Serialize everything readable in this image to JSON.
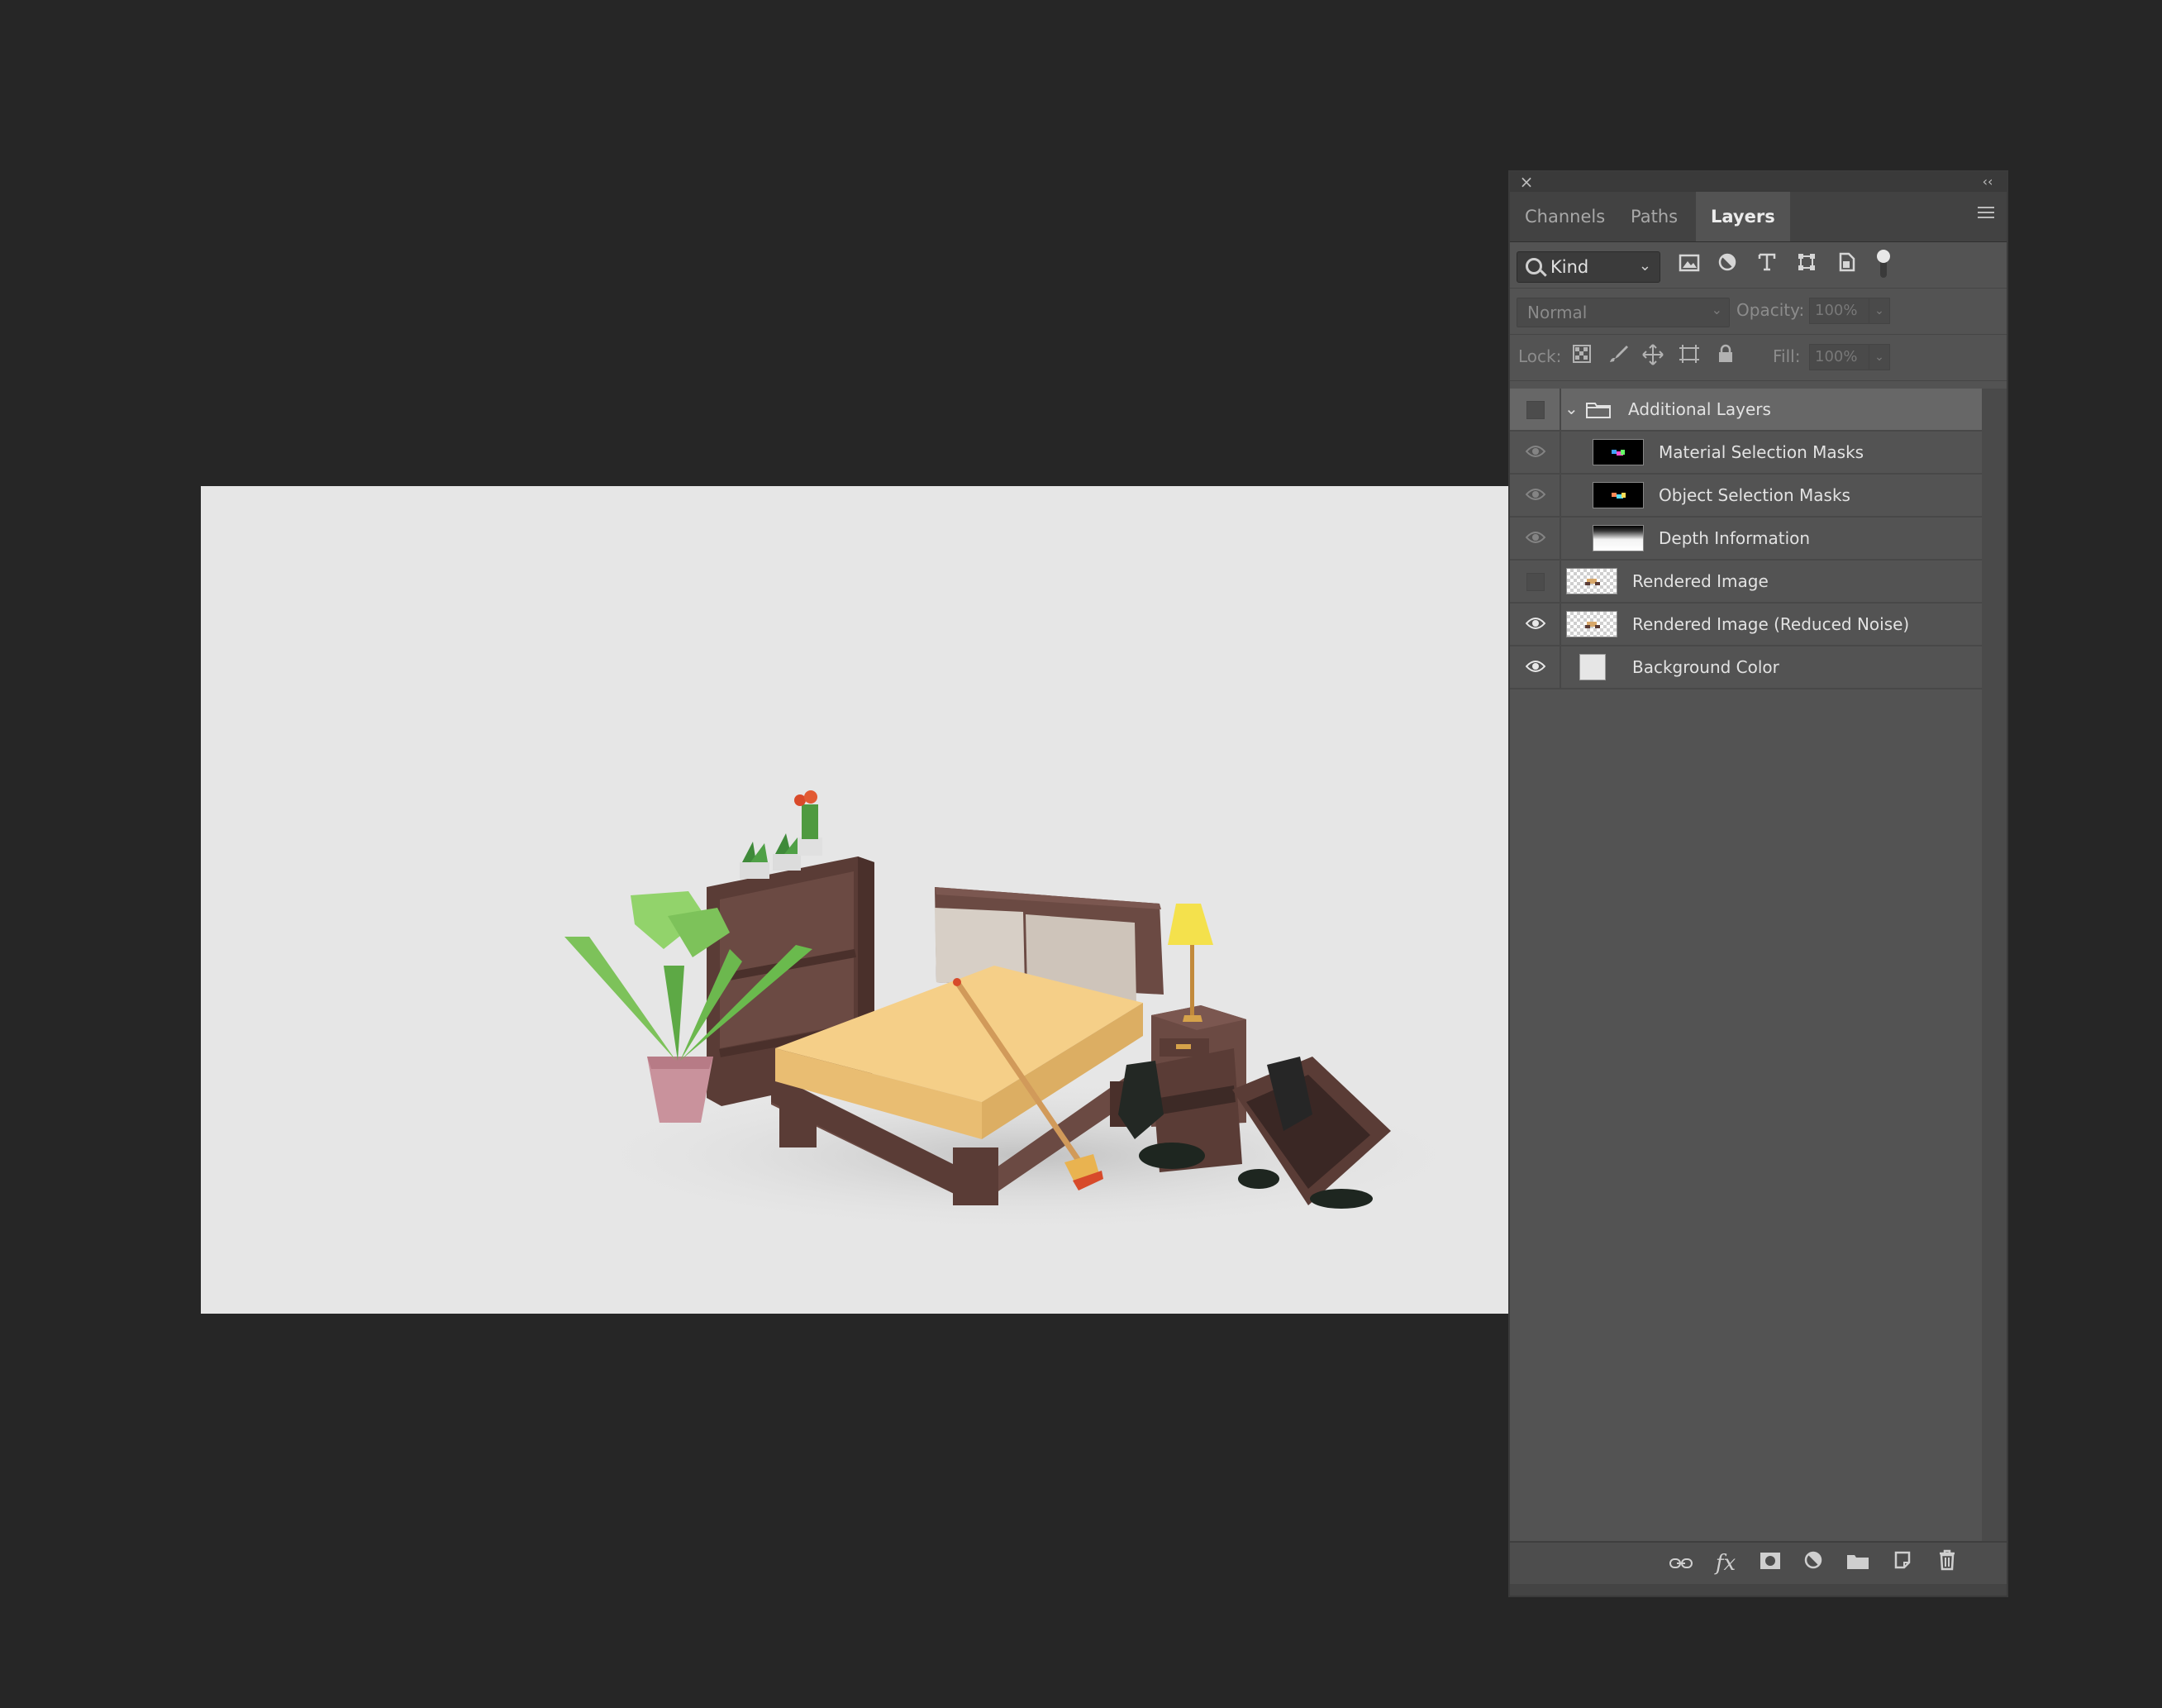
{
  "panel": {
    "close_glyph": "×",
    "collapse_glyph": "‹‹",
    "tabs": [
      {
        "label": "Channels",
        "active": false
      },
      {
        "label": "Paths",
        "active": false
      },
      {
        "label": "Layers",
        "active": true
      }
    ],
    "filter": {
      "kind_label": "Kind",
      "icons": [
        "image-filter-icon",
        "adjustment-filter-icon",
        "type-filter-icon",
        "shape-filter-icon",
        "smart-object-filter-icon"
      ]
    },
    "blend": {
      "mode": "Normal",
      "opacity_label": "Opacity:",
      "opacity_value": "100%",
      "fill_label": "Fill:",
      "fill_value": "100%"
    },
    "lock": {
      "label": "Lock:",
      "icons": [
        "lock-transparent-icon",
        "lock-image-icon",
        "lock-position-icon",
        "lock-artboard-icon",
        "lock-all-icon"
      ]
    },
    "layers": [
      {
        "name": "Additional Layers",
        "type": "group",
        "visible": false
      },
      {
        "name": "Material Selection Masks",
        "type": "child",
        "visible": true,
        "thumb": "black"
      },
      {
        "name": "Object Selection Masks",
        "type": "child",
        "visible": true,
        "thumb": "black"
      },
      {
        "name": "Depth Information",
        "type": "child",
        "visible": true,
        "thumb": "depth"
      },
      {
        "name": "Rendered Image",
        "type": "layer",
        "visible": false,
        "thumb": "checker"
      },
      {
        "name": "Rendered Image (Reduced Noise)",
        "type": "layer",
        "visible": true,
        "thumb": "checker"
      },
      {
        "name": "Background Color",
        "type": "layer",
        "visible": true,
        "thumb": "solid"
      }
    ],
    "bottom_icons": [
      "link-layers-icon",
      "fx-icon",
      "add-mask-icon",
      "adjustment-layer-icon",
      "new-group-icon",
      "new-layer-icon",
      "delete-layer-icon"
    ],
    "fx_label": "fx"
  },
  "colors": {
    "workspace": "#262626",
    "panel": "#535353",
    "canvas": "#e6e6e6"
  }
}
